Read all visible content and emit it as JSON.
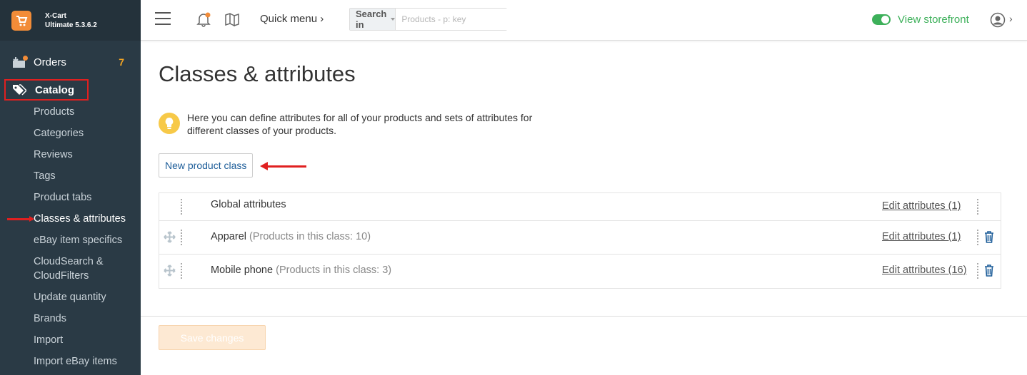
{
  "brand": {
    "name": "X-Cart",
    "edition": "Ultimate 5.3.6.2",
    "icon": "cart-logo-icon"
  },
  "sidebar": {
    "orders": {
      "label": "Orders",
      "count": "7"
    },
    "catalog": {
      "label": "Catalog"
    },
    "items": [
      {
        "label": "Products"
      },
      {
        "label": "Categories"
      },
      {
        "label": "Reviews"
      },
      {
        "label": "Tags"
      },
      {
        "label": "Product tabs"
      },
      {
        "label": "Classes & attributes",
        "active": true
      },
      {
        "label": "eBay item specifics"
      },
      {
        "label": "CloudSearch &"
      },
      {
        "label": "CloudFilters"
      },
      {
        "label": "Update quantity"
      },
      {
        "label": "Brands"
      },
      {
        "label": "Import"
      },
      {
        "label": "Import eBay items"
      }
    ]
  },
  "topbar": {
    "quick_menu": "Quick menu",
    "search": {
      "select_label": "Search in",
      "placeholder": "Products - p: key"
    },
    "storefront": "View storefront"
  },
  "main": {
    "title": "Classes & attributes",
    "info_line1": "Here you can define attributes for all of your products and sets of attributes for",
    "info_line2": "different classes of your products.",
    "new_button": "New product class",
    "rows": [
      {
        "name": "Global attributes",
        "extra": "",
        "link": "Edit attributes (1)"
      },
      {
        "name": "Apparel",
        "extra": "(Products in this class: 10)",
        "link": "Edit attributes (1)"
      },
      {
        "name": "Mobile phone",
        "extra": "(Products in this class: 3)",
        "link": "Edit attributes (16)"
      }
    ],
    "save_button": "Save changes"
  },
  "colors": {
    "sidebar": "#2a3a45",
    "accent": "#f28c38",
    "green": "#3db05a",
    "link": "#1d5d99",
    "annotation": "#e02020"
  }
}
